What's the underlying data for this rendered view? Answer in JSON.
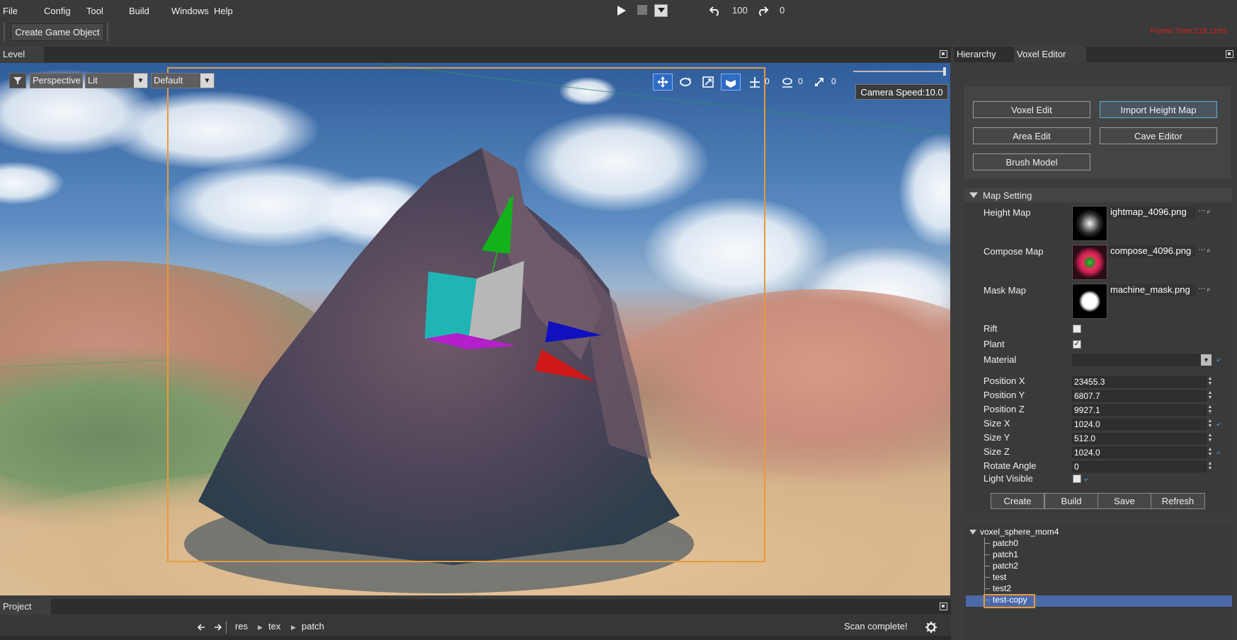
{
  "menu": {
    "file": "File",
    "config": "Config",
    "tool": "Tool",
    "build": "Build",
    "windows": "Windows",
    "help": "Help"
  },
  "toolbar": {
    "undo_count": "100",
    "redo_count": "0",
    "frame_time": "Frame Time:118.11ms",
    "create_game_object": "Create Game Object"
  },
  "level": {
    "tab": "Level",
    "perspective": "Perspective",
    "lit": "Lit",
    "default": "Default",
    "gizmo_move_count": "0",
    "gizmo_rotate_count": "0",
    "gizmo_scale_count": "0",
    "camera_speed": "Camera Speed:10.0",
    "camera_speed_level": 1.0
  },
  "project": {
    "tab": "Project",
    "breadcrumbs": [
      "res",
      "tex",
      "patch"
    ],
    "status": "Scan complete!"
  },
  "right_panel": {
    "tabs": [
      "Hierarchy",
      "Voxel Editor"
    ],
    "active_tab": "Voxel Editor",
    "tools": {
      "voxel_edit": "Voxel Edit",
      "import_height_map": "Import Height Map",
      "area_edit": "Area Edit",
      "cave_editor": "Cave Editor",
      "brush_model": "Brush Model"
    },
    "map_setting": {
      "header": "Map Setting",
      "height_map_label": "Height Map",
      "height_map_file": "ightmap_4096.png",
      "compose_map_label": "Compose Map",
      "compose_map_file": "compose_4096.png",
      "mask_map_label": "Mask Map",
      "mask_map_file": "machine_mask.png",
      "rift_label": "Rift",
      "rift_checked": false,
      "plant_label": "Plant",
      "plant_checked": true,
      "material_label": "Material",
      "fields": [
        {
          "label": "Position X",
          "value": "23455.3"
        },
        {
          "label": "Position Y",
          "value": "6807.7"
        },
        {
          "label": "Position Z",
          "value": "9927.1"
        },
        {
          "label": "Size X",
          "value": "1024.0"
        },
        {
          "label": "Size Y",
          "value": "512.0"
        },
        {
          "label": "Size Z",
          "value": "1024.0"
        },
        {
          "label": "Rotate Angle",
          "value": "0"
        }
      ],
      "light_visible_label": "Light Visible",
      "light_visible_checked": false,
      "actions": [
        "Create",
        "Build",
        "Save",
        "Refresh"
      ]
    },
    "tree": {
      "root": "voxel_sphere_mom4",
      "children": [
        "patch0",
        "patch1",
        "patch2",
        "test",
        "test2",
        "test-copy"
      ],
      "selected": "test-copy"
    }
  },
  "colors": {
    "accent_orange": "#e89a3c",
    "selection_blue": "#4c6aa8",
    "frame_time_red": "#d32020",
    "active_gizmo": "#2d6bc4"
  }
}
